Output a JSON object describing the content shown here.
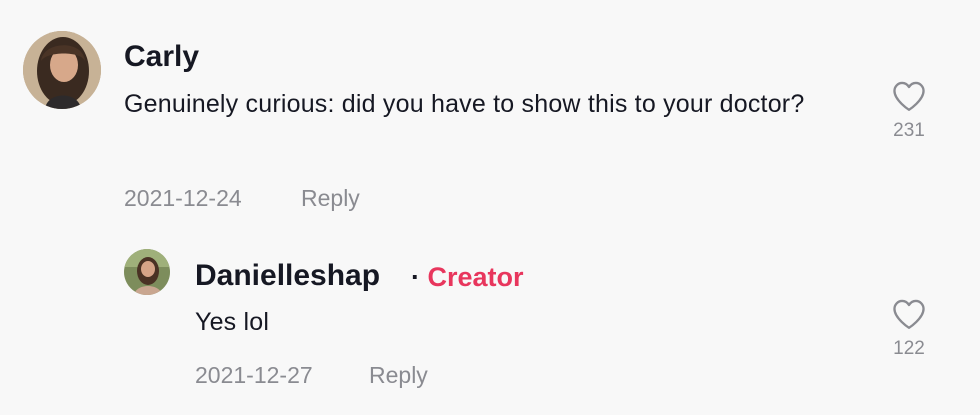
{
  "comments": [
    {
      "username": "Carly",
      "text": "Genuinely curious: did you have to show this to your doctor?",
      "date": "2021-12-24",
      "reply_label": "Reply",
      "likes": "231",
      "avatar": "woman-with-long-brown-hair-avatar"
    }
  ],
  "replies": [
    {
      "username": "Danielleshap",
      "separator": "·",
      "badge": "Creator",
      "text": "Yes lol",
      "date": "2021-12-27",
      "reply_label": "Reply",
      "likes": "122",
      "avatar": "woman-outdoors-avatar"
    }
  ],
  "colors": {
    "background": "#f8f8f8",
    "text_primary": "#161823",
    "text_secondary": "#8a8b91",
    "creator_badge": "#e8365d"
  },
  "icons": {
    "like": "heart-outline-icon"
  }
}
